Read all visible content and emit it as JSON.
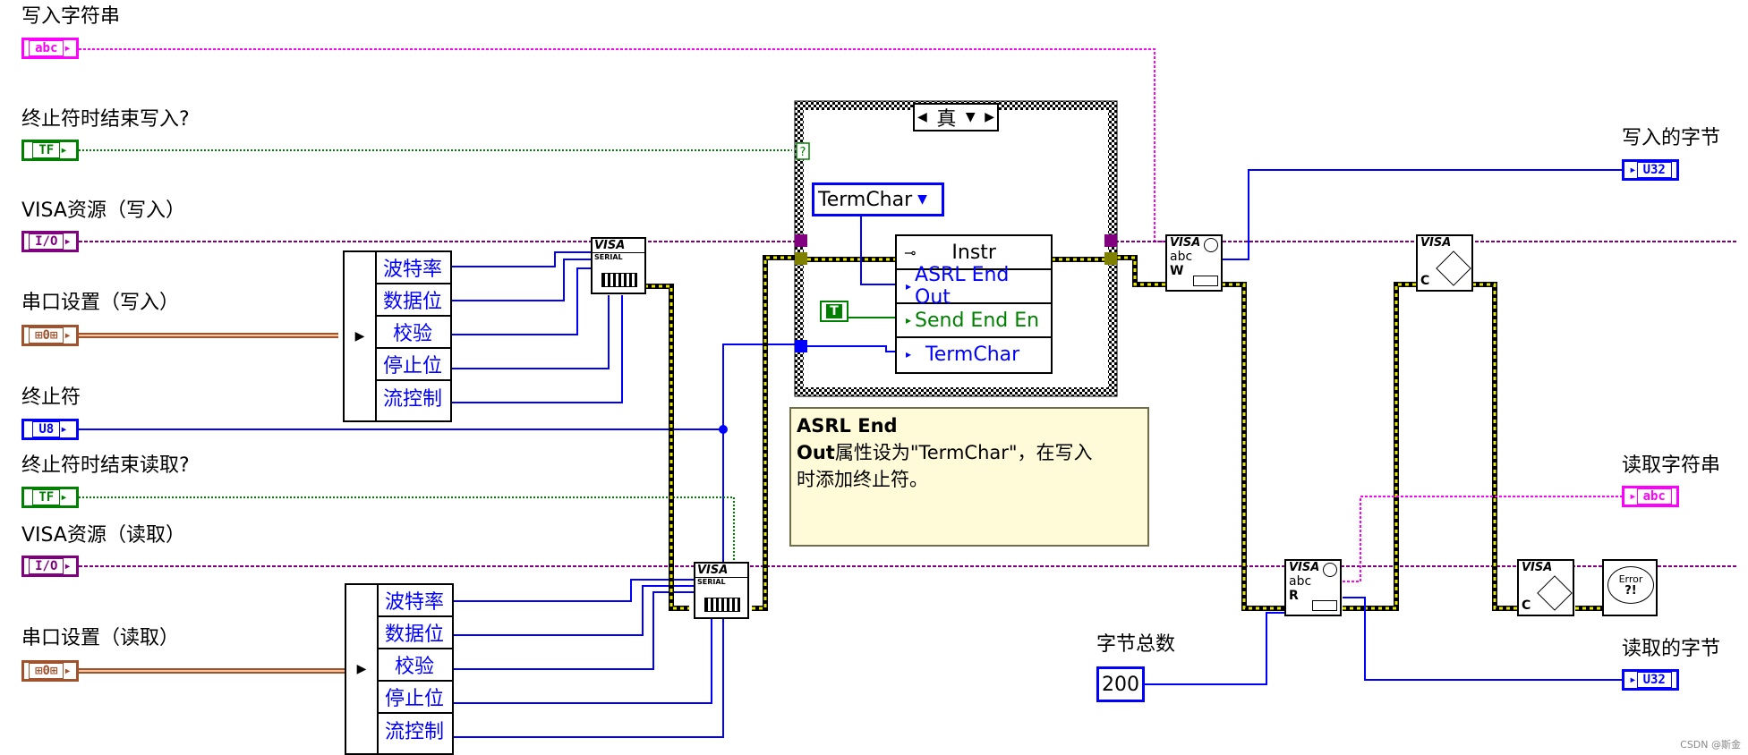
{
  "controls": {
    "write_string": {
      "label": "写入字符串",
      "tag": "abc"
    },
    "end_write_on_term": {
      "label": "终止符时结束写入?",
      "tag": "TF"
    },
    "visa_write": {
      "label": "VISA资源（写入）",
      "tag": "I/O"
    },
    "serial_write": {
      "label": "串口设置（写入）",
      "tag": "⊞0⊞"
    },
    "term_char": {
      "label": "终止符",
      "tag": "U8"
    },
    "end_read_on_term": {
      "label": "终止符时结束读取?",
      "tag": "TF"
    },
    "visa_read": {
      "label": "VISA资源（读取）",
      "tag": "I/O"
    },
    "serial_read": {
      "label": "串口设置（读取）",
      "tag": "⊞0⊞"
    },
    "byte_count": {
      "label": "字节总数",
      "value": "200"
    }
  },
  "indicators": {
    "bytes_written": {
      "label": "写入的字节",
      "tag": "U32"
    },
    "read_string": {
      "label": "读取字符串",
      "tag": "abc"
    },
    "bytes_read": {
      "label": "读取的字节",
      "tag": "U32"
    }
  },
  "unbundle_top": [
    "波特率",
    "数据位",
    "校验",
    "停止位",
    "流控制"
  ],
  "unbundle_bottom": [
    "波特率",
    "数据位",
    "校验",
    "停止位",
    "流控制"
  ],
  "case_structure": {
    "selector": "真",
    "selector_terminal": "?"
  },
  "enum_constant": "TermChar",
  "bool_constant": "T",
  "property_node": {
    "class": "Instr",
    "rows": [
      "ASRL End Out",
      "Send End En",
      "TermChar"
    ]
  },
  "comment": {
    "bold": "ASRL End Out",
    "rest": "属性设为\"TermChar\"，在写入时添加终止符。",
    "line1_bold": "ASRL End",
    "line2_bold": "Out",
    "line2_rest": "属性设为\"TermChar\"，在写入",
    "line3": "时添加终止符。"
  },
  "nodes": {
    "visa_serial_label": "VISA",
    "visa_serial_sub": "SERIAL",
    "visa_write_letter": "W",
    "visa_read_letter": "R",
    "visa_close_letter": "C",
    "abc": "abc",
    "error_text": "Error"
  },
  "watermark": "CSDN @斯金",
  "colors": {
    "string_wire": "#ff00ff",
    "bool_wire": "#008000",
    "refnum_wire": "#800080",
    "cluster_wire": "#a0522d",
    "numeric_wire": "#0000ff",
    "error_wire": "#c8c800"
  }
}
